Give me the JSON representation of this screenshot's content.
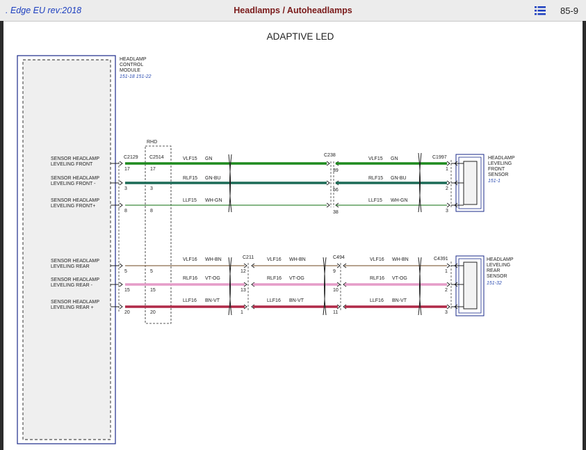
{
  "header": {
    "doc_label": "Edge EU rev:2018",
    "doc_prefix": ".",
    "title": "Headlamps / Autoheadlamps",
    "page_number": "85-9",
    "menu_icon": "list-icon"
  },
  "diagram": {
    "title": "ADAPTIVE LED",
    "module": {
      "lines": [
        "HEADLAMP",
        "CONTROL",
        "MODULE"
      ],
      "ref": "151-18  151-22"
    },
    "rhd_label": "RHD",
    "connectors": {
      "c2129": "C2129",
      "c2514": "C2514",
      "c238": "C238",
      "c1997": "C1997",
      "c211": "C211",
      "c494": "C494",
      "c4391": "C4391"
    },
    "front_sensor": {
      "lines": [
        "HEADLAMP",
        "LEVELING",
        "FRONT",
        "SENSOR"
      ],
      "ref": "151-1"
    },
    "rear_sensor": {
      "lines": [
        "HEADLAMP",
        "LEVELING",
        "REAR",
        "SENSOR"
      ],
      "ref": "151-32"
    },
    "signals": [
      {
        "l1": "SENSOR HEADLAMP",
        "l2": "LEVELING FRONT",
        "c2129_pin": "17",
        "c2514_pin": "17",
        "circuit_a": "VLF15",
        "color_a": "GN",
        "mid_pin": "39",
        "circuit_b": "VLF15",
        "color_b": "GN",
        "end_pin": "1",
        "wire_color": "#1e8a1e",
        "wire_weight": "heavy"
      },
      {
        "l1": "SENSOR HEADLAMP",
        "l2": "LEVELING FRONT -",
        "c2129_pin": "3",
        "c2514_pin": "3",
        "circuit_a": "RLF15",
        "color_a": "GN-BU",
        "mid_pin": "56",
        "circuit_b": "RLF15",
        "color_b": "GN-BU",
        "end_pin": "2",
        "wire_color": "#1c6b57",
        "wire_weight": "heavy"
      },
      {
        "l1": "SENSOR HEADLAMP",
        "l2": "LEVELING FRONT+",
        "c2129_pin": "8",
        "c2514_pin": "8",
        "circuit_a": "LLF15",
        "color_a": "WH-GN",
        "mid_pin": "38",
        "circuit_b": "LLF15",
        "color_b": "WH-GN",
        "end_pin": "3",
        "wire_color": "#3c8a3c",
        "wire_weight": "thin"
      },
      {
        "l1": "SENSOR HEADLAMP",
        "l2": "LEVELING REAR",
        "c2129_pin": "5",
        "c2514_pin": "5",
        "circuit_a": "VLF16",
        "color_a": "WH-BN",
        "mid1_pin": "12",
        "circuit_b": "VLF16",
        "color_b": "WH-BN",
        "mid2_pin": "9",
        "circuit_c": "VLF16",
        "color_c": "WH-BN",
        "end_pin": "1",
        "wire_color": "#8a6a4a",
        "wire_weight": "thin"
      },
      {
        "l1": "SENSOR HEADLAMP",
        "l2": "LEVELING REAR -",
        "c2129_pin": "15",
        "c2514_pin": "15",
        "circuit_a": "RLF16",
        "color_a": "VT-OG",
        "mid1_pin": "13",
        "circuit_b": "RLF16",
        "color_b": "VT-OG",
        "mid2_pin": "10",
        "circuit_c": "RLF16",
        "color_c": "VT-OG",
        "end_pin": "2",
        "wire_color": "#e59cc8",
        "wire_weight": "heavy"
      },
      {
        "l1": "SENSOR HEADLAMP",
        "l2": "LEVELING REAR +",
        "c2129_pin": "20",
        "c2514_pin": "20",
        "circuit_a": "LLF16",
        "color_a": "BN-VT",
        "mid1_pin": "1",
        "circuit_b": "LLF16",
        "color_b": "BN-VT",
        "mid2_pin": "11",
        "circuit_c": "LLF16",
        "color_c": "BN-VT",
        "end_pin": "3",
        "wire_color": "#b02a48",
        "wire_weight": "heavy"
      }
    ]
  }
}
